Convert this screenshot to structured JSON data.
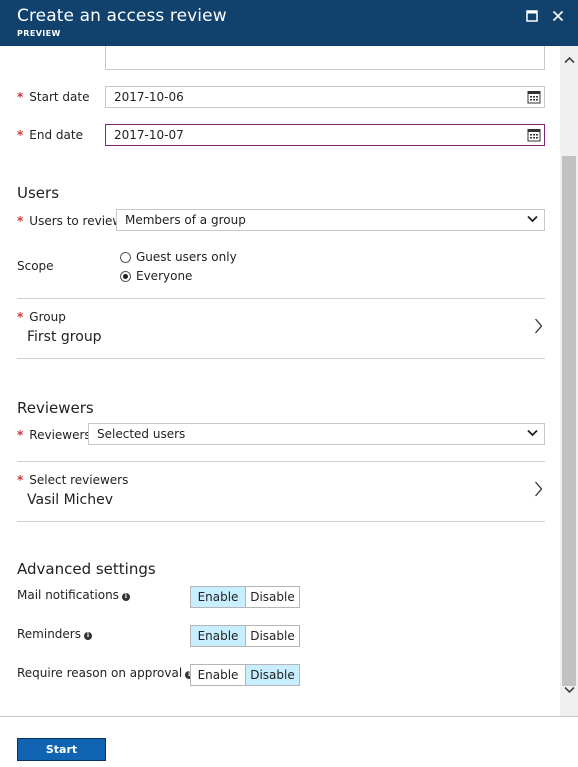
{
  "header": {
    "title": "Create an access review",
    "subtitle": "PREVIEW",
    "maximize_icon": "maximize-icon",
    "close_icon": "close-icon"
  },
  "dates": {
    "start_label": "Start date",
    "start_value": "2017-10-06",
    "end_label": "End date",
    "end_value": "2017-10-07"
  },
  "users": {
    "title": "Users",
    "users_to_review_label": "Users to review",
    "users_to_review_value": "Members of a group",
    "scope_label": "Scope",
    "scope_options": [
      "Guest users only",
      "Everyone"
    ],
    "scope_selected": "Everyone",
    "group_label": "Group",
    "group_value": "First group"
  },
  "reviewers": {
    "title": "Reviewers",
    "reviewers_label": "Reviewers",
    "reviewers_value": "Selected users",
    "select_reviewers_label": "Select reviewers",
    "select_reviewers_value": "Vasil Michev"
  },
  "advanced": {
    "title": "Advanced settings",
    "enable_label": "Enable",
    "disable_label": "Disable",
    "mail_notifications_label": "Mail notifications",
    "mail_notifications_value": "Enable",
    "reminders_label": "Reminders",
    "reminders_value": "Enable",
    "require_reason_label": "Require reason on approval",
    "require_reason_value": "Disable"
  },
  "footer": {
    "start_button": "Start"
  },
  "colors": {
    "header_bg": "#11426e",
    "required": "#d13438",
    "selected_toggle": "#c7efff",
    "primary_button": "#1064b1",
    "focus_border": "#7d2472"
  }
}
